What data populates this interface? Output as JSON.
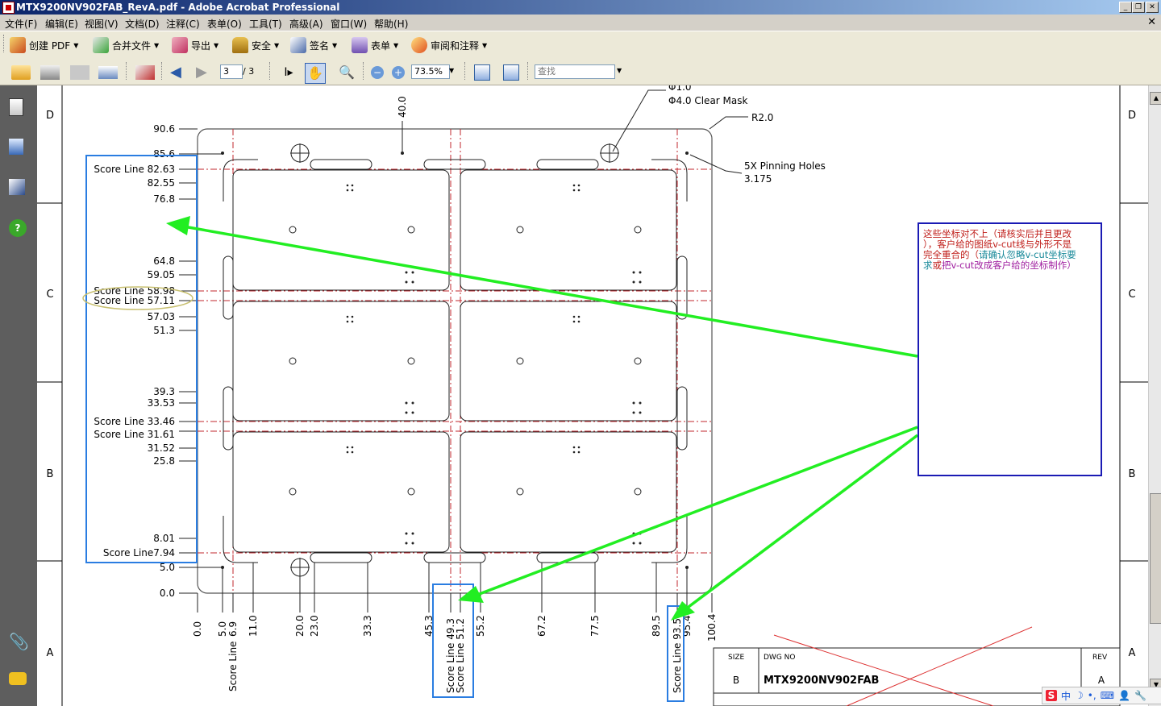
{
  "window": {
    "title": "MTX9200NV902FAB_RevA.pdf - Adobe Acrobat Professional"
  },
  "menu": [
    "文件(F)",
    "编辑(E)",
    "视图(V)",
    "文档(D)",
    "注释(C)",
    "表单(O)",
    "工具(T)",
    "高级(A)",
    "窗口(W)",
    "帮助(H)"
  ],
  "toolbar1": {
    "create_pdf": "创建 PDF",
    "combine": "合并文件",
    "export": "导出",
    "security": "安全",
    "sign": "签名",
    "forms": "表单",
    "review": "审阅和注释"
  },
  "toolbar2": {
    "page_current": "3",
    "page_total": "/ 3",
    "zoom": "73.5%",
    "search_placeholder": "查找"
  },
  "drawing": {
    "zone_labels": [
      "D",
      "C",
      "B",
      "A"
    ],
    "top_dim": "40.0",
    "hole_note_1": "Φ1.0",
    "hole_note_2": "Φ4.0  Clear Mask",
    "radius_note": "R2.0",
    "pinning_note_1": "5X Pinning Holes",
    "pinning_note_2": "3.175",
    "y_labels": [
      "90.6",
      "85.6",
      "Score Line 82.63",
      "82.55",
      "76.8",
      "64.8",
      "59.05",
      "Score Line 58.98",
      "Score Line  57.11",
      "57.03",
      "51.3",
      "39.3",
      "33.53",
      "Score Line 33.46",
      "Score Line 31.61",
      "31.52",
      "25.8",
      "8.01",
      "Score Line7.94",
      "5.0",
      "0.0"
    ],
    "x_labels": [
      "0.0",
      "5.0",
      "6.9",
      "11.0",
      "20.0",
      "23.0",
      "33.3",
      "45.3",
      "55.2",
      "67.2",
      "77.5",
      "89.5",
      "95.4",
      "100.4"
    ],
    "x_score_labels": [
      "Score Line",
      "Score Line 49.3",
      "Score Line 51.2",
      "Score Line 93.5"
    ],
    "annotation_text": [
      "这些坐标对不上（请核实后并且更改",
      "），客户给的图纸v-cut线与外形不是",
      "完全重合的（",
      "请确认忽略v-cut坐标要",
      "求",
      "或",
      "把v-cut改成客户给的坐标制作）"
    ],
    "title_block": {
      "size_label": "SIZE",
      "size_value": "B",
      "dwg_label": "DWG NO",
      "dwg_value": "MTX9200NV902FAB",
      "rev_label": "REV",
      "rev_value": "A"
    }
  },
  "colors": {
    "annotation_arrow": "#22ee22",
    "highlight_box": "#2a7de1",
    "vcut": "#c0272d",
    "note_box": "#1a1ab4"
  }
}
